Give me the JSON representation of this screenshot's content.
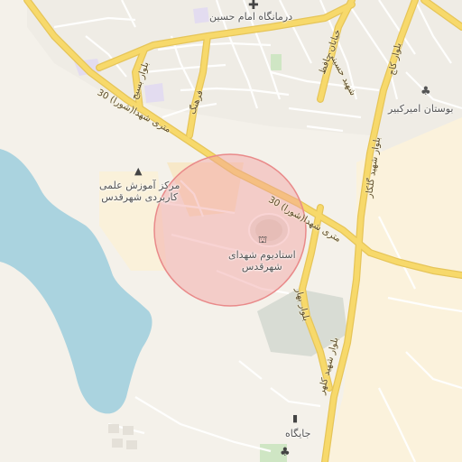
{
  "map": {
    "pois": [
      {
        "name": "درمانگاه امام حسین",
        "icon": "medical-cross-icon"
      },
      {
        "name": "بوستان امیرکبیر",
        "icon": "park-tree-icon"
      },
      {
        "name": "مرکز آموزش علمی کاربردی شهرقدس",
        "line1": "مرکز آموزش علمی",
        "line2": "کاربردی شهرقدس",
        "icon": "graduation-cap-icon"
      },
      {
        "name": "استادیوم شهدای شهرقدس",
        "line1": "استادیوم شهدای",
        "line2": "شهرقدس",
        "icon": "stadium-icon"
      },
      {
        "name": "جایگاه",
        "icon": "fuel-pump-icon"
      }
    ],
    "roads": [
      {
        "name": "30 متری شهدا(شورا)"
      },
      {
        "name": "30 متری شهدا(شورا)"
      },
      {
        "name": "بلوار بسیج"
      },
      {
        "name": "فرهنگ"
      },
      {
        "name": "خیابان حافظ"
      },
      {
        "name": "شهید حسینی"
      },
      {
        "name": "بلوار کاج"
      },
      {
        "name": "بلوار شهید گلکار"
      },
      {
        "name": "بلوار بهار"
      },
      {
        "name": "بلوار شهید کلهر"
      }
    ],
    "colors": {
      "land": "#f4f1ea",
      "water": "#aad3df",
      "major_road": "#f7d96b",
      "highlight_circle": "#f2a0a0"
    }
  }
}
